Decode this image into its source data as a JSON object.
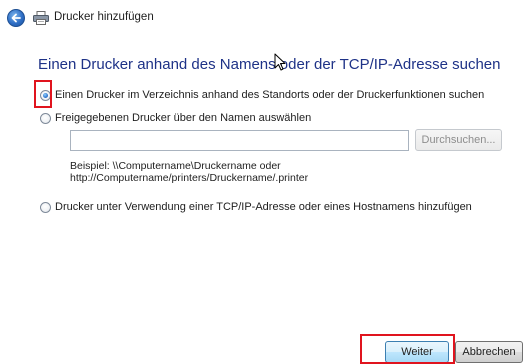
{
  "window": {
    "title": "Drucker hinzufügen"
  },
  "main": {
    "heading": "Einen Drucker anhand des Namens oder der TCP/IP-Adresse suchen",
    "options": [
      {
        "label": "Einen Drucker im Verzeichnis anhand des Standorts oder der Druckerfunktionen suchen",
        "checked": true
      },
      {
        "label": "Freigegebenen Drucker über den Namen auswählen",
        "checked": false
      },
      {
        "label": "Drucker unter Verwendung einer TCP/IP-Adresse oder eines Hostnamens hinzufügen",
        "checked": false
      }
    ],
    "shared_printer": {
      "input_value": "",
      "browse_label": "Durchsuchen...",
      "example_line1": "Beispiel: \\\\Computername\\Druckername oder",
      "example_line2": "http://Computername/printers/Druckername/.printer"
    }
  },
  "footer": {
    "next_label": "Weiter",
    "cancel_label": "Abbrechen"
  },
  "annotations": {
    "highlight_color": "#e0141e"
  }
}
